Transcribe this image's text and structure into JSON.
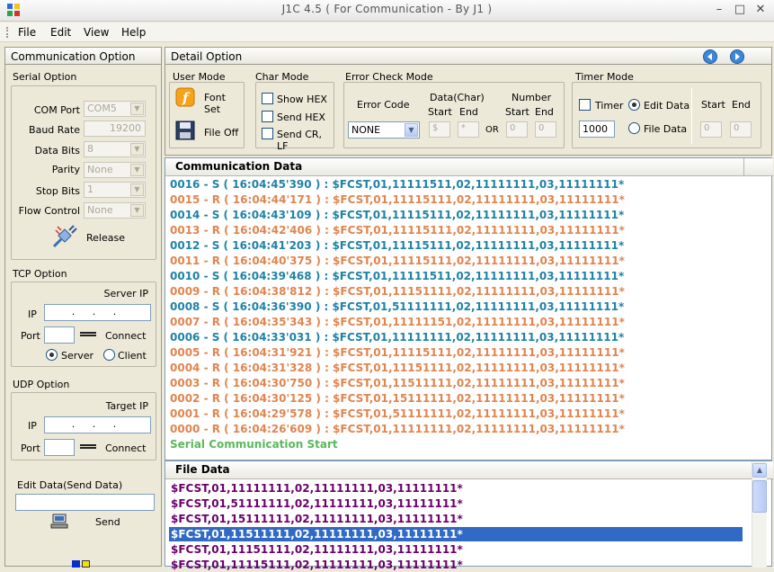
{
  "window": {
    "title": "J1C 4.5 ( For Communication - By J1 )",
    "controls": {
      "minimize": "–",
      "maximize": "□",
      "close": "✕"
    }
  },
  "menu": [
    "File",
    "Edit",
    "View",
    "Help"
  ],
  "left_panel": {
    "title": "Communication Option",
    "serial": {
      "title": "Serial Option",
      "fields": [
        {
          "label": "COM Port",
          "value": "COM5"
        },
        {
          "label": "Baud Rate",
          "value": "19200"
        },
        {
          "label": "Data Bits",
          "value": "8"
        },
        {
          "label": "Parity",
          "value": "None"
        },
        {
          "label": "Stop Bits",
          "value": "1"
        },
        {
          "label": "Flow Control",
          "value": "None"
        }
      ],
      "release_label": "Release"
    },
    "tcp": {
      "title": "TCP Option",
      "server_ip_label": "Server IP",
      "ip_label": "IP",
      "ip_value": ".  .  .",
      "port_label": "Port",
      "connect_label": "Connect",
      "server_label": "Server",
      "client_label": "Client"
    },
    "udp": {
      "title": "UDP Option",
      "target_ip_label": "Target IP",
      "ip_label": "IP",
      "ip_value": ".  .  .",
      "port_label": "Port",
      "connect_label": "Connect"
    },
    "edit": {
      "title": "Edit Data(Send Data)",
      "send_label": "Send"
    }
  },
  "detail": {
    "title": "Detail Option",
    "user_mode": {
      "title": "User Mode",
      "font_set": "Font Set",
      "file_label": "File",
      "file_state": "Off"
    },
    "char_mode": {
      "title": "Char Mode",
      "show_hex": "Show HEX",
      "send_hex": "Send HEX",
      "send_crlf": "Send CR, LF"
    },
    "error_check": {
      "title": "Error Check Mode",
      "error_code_label": "Error Code",
      "error_code_value": "NONE",
      "data_char_label": "Data(Char)",
      "number_label": "Number",
      "start_label": "Start",
      "end_label": "End",
      "or_label": "OR",
      "data_start": "$",
      "data_end": "*",
      "num_start": "0",
      "num_end": "0"
    },
    "timer": {
      "title": "Timer Mode",
      "timer_label": "Timer",
      "edit_data_label": "Edit Data",
      "file_data_label": "File Data",
      "interval": "1000",
      "start_label": "Start",
      "end_label": "End",
      "start_value": "0",
      "end_value": "0"
    }
  },
  "comm": {
    "title": "Communication Data",
    "lines": [
      {
        "dir": "S",
        "text": "0016 - S ( 16:04:45'390  ) : $FCST,01,11111511,02,11111111,03,11111111*"
      },
      {
        "dir": "R",
        "text": "0015 - R ( 16:04:44'171  ) : $FCST,01,11115111,02,11111111,03,11111111*"
      },
      {
        "dir": "S",
        "text": "0014 - S ( 16:04:43'109  ) : $FCST,01,11115111,02,11111111,03,11111111*"
      },
      {
        "dir": "R",
        "text": "0013 - R ( 16:04:42'406  ) : $FCST,01,11115111,02,11111111,03,11111111*"
      },
      {
        "dir": "S",
        "text": "0012 - S ( 16:04:41'203  ) : $FCST,01,11115111,02,11111111,03,11111111*"
      },
      {
        "dir": "R",
        "text": "0011 - R ( 16:04:40'375  ) : $FCST,01,11115111,02,11111111,03,11111111*"
      },
      {
        "dir": "S",
        "text": "0010 - S ( 16:04:39'468  ) : $FCST,01,11111511,02,11111111,03,11111111*"
      },
      {
        "dir": "R",
        "text": "0009 - R ( 16:04:38'812  ) : $FCST,01,11151111,02,11111111,03,11111111*"
      },
      {
        "dir": "S",
        "text": "0008 - S ( 16:04:36'390  ) : $FCST,01,51111111,02,11111111,03,11111111*"
      },
      {
        "dir": "R",
        "text": "0007 - R ( 16:04:35'343  ) : $FCST,01,11111151,02,11111111,03,11111111*"
      },
      {
        "dir": "S",
        "text": "0006 - S ( 16:04:33'031  ) : $FCST,01,11111111,02,11111111,03,11111111*"
      },
      {
        "dir": "R",
        "text": "0005 - R ( 16:04:31'921  ) : $FCST,01,11115111,02,11111111,03,11111111*"
      },
      {
        "dir": "R",
        "text": "0004 - R ( 16:04:31'328  ) : $FCST,01,11151111,02,11111111,03,11111111*"
      },
      {
        "dir": "R",
        "text": "0003 - R ( 16:04:30'750  ) : $FCST,01,11511111,02,11111111,03,11111111*"
      },
      {
        "dir": "R",
        "text": "0002 - R ( 16:04:30'125  ) : $FCST,01,15111111,02,11111111,03,11111111*"
      },
      {
        "dir": "R",
        "text": "0001 - R ( 16:04:29'578  ) : $FCST,01,51111111,02,11111111,03,11111111*"
      },
      {
        "dir": "R",
        "text": "0000 - R ( 16:04:26'609  ) : $FCST,01,11111111,02,11111111,03,11111111*"
      }
    ],
    "start_message": "Serial Communication Start"
  },
  "file": {
    "title": "File Data",
    "lines": [
      "$FCST,01,11111111,02,11111111,03,11111111*",
      "$FCST,01,51111111,02,11111111,03,11111111*",
      "$FCST,01,15111111,02,11111111,03,11111111*",
      "$FCST,01,11511111,02,11111111,03,11111111*",
      "$FCST,01,11151111,02,11111111,03,11111111*",
      "$FCST,01,11115111,02,11111111,03,11111111*"
    ],
    "selected_index": 3
  },
  "colors": {
    "send": "#1f82a6",
    "receive": "#e0854f",
    "start": "#5cb85c",
    "file_text": "#6b006b",
    "selection": "#316ac5"
  }
}
